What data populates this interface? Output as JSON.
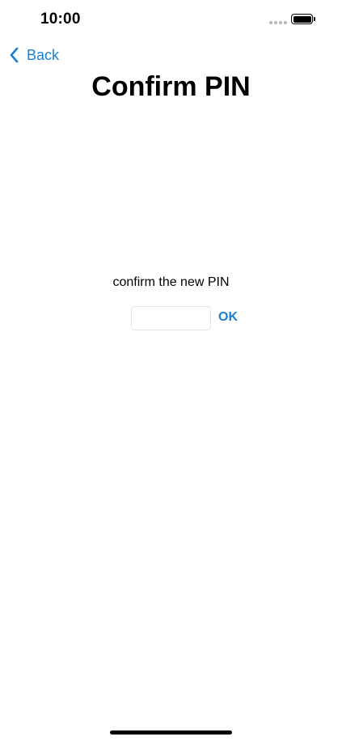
{
  "status_bar": {
    "time": "10:00",
    "signal_icon": "signal-dots-icon",
    "battery_icon": "battery-full-icon"
  },
  "nav": {
    "back_label": "Back",
    "back_icon": "chevron-left-icon",
    "title": "Confirm PIN"
  },
  "form": {
    "prompt": "confirm the new PIN",
    "pin_value": "",
    "pin_placeholder": "",
    "ok_label": "OK"
  },
  "colors": {
    "accent": "#1a7fd6",
    "text": "#000000",
    "background": "#ffffff",
    "input_border": "#e3e3e3"
  }
}
